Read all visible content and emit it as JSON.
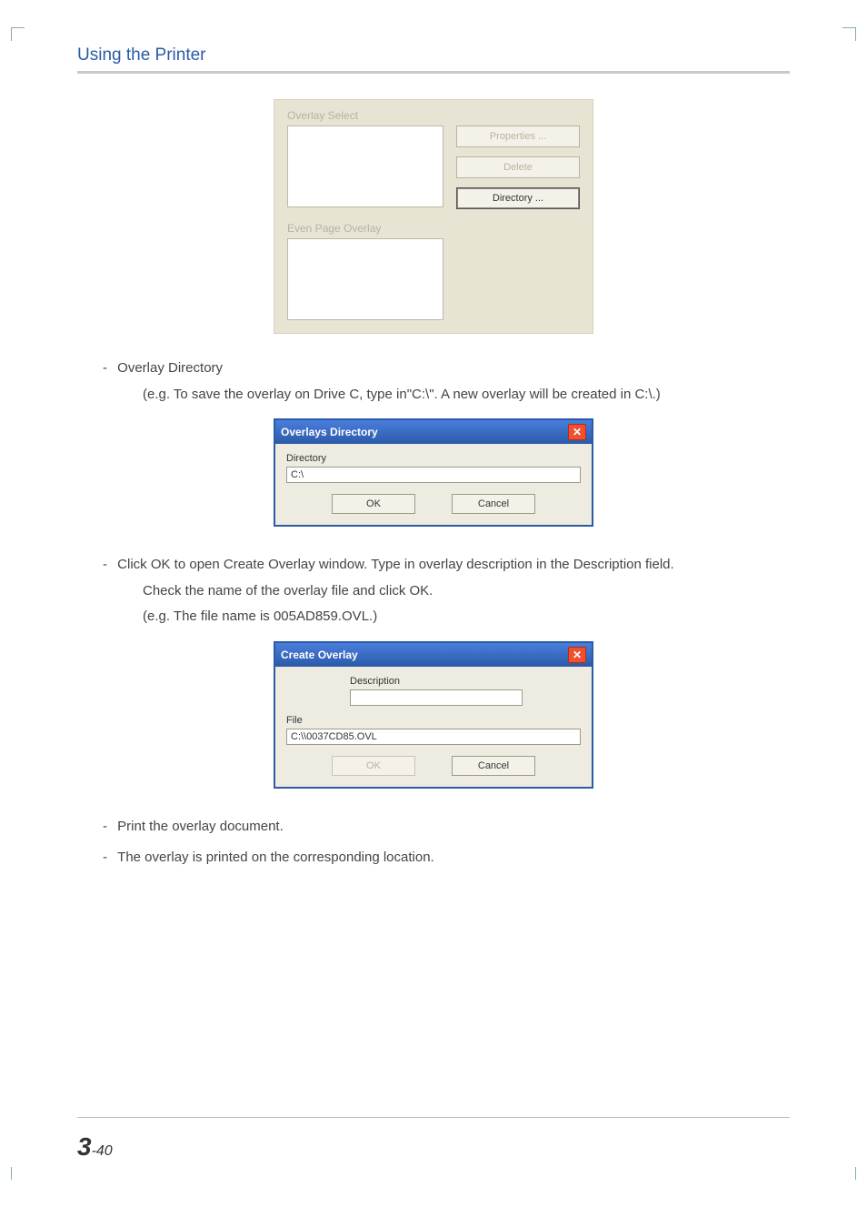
{
  "header": {
    "title": "Using the Printer"
  },
  "panel1": {
    "overlaySelectLabel": "Overlay Select",
    "evenPageOverlayLabel": "Even Page Overlay",
    "buttons": {
      "properties": "Properties ...",
      "delete": "Delete",
      "directory": "Directory ..."
    }
  },
  "text1": {
    "line1": "Overlay Directory",
    "line2": "(e.g. To save the overlay on Drive C, type in\"C:\\\". A new overlay will be created in C:\\.)"
  },
  "dialog1": {
    "title": "Overlays Directory",
    "dirLabel": "Directory",
    "dirValue": "C:\\",
    "ok": "OK",
    "cancel": "Cancel"
  },
  "text2": {
    "line1": "Click OK to open Create Overlay window. Type in overlay description in the Description field.",
    "line2": "Check the name of the overlay file and click OK.",
    "line3": "(e.g. The file name is 005AD859.OVL.)"
  },
  "dialog2": {
    "title": "Create Overlay",
    "descLabel": "Description",
    "descValue": "",
    "fileLabel": "File",
    "fileValue": "C:\\\\0037CD85.OVL",
    "ok": "OK",
    "cancel": "Cancel"
  },
  "text3": {
    "line1": "Print the overlay document.",
    "line2": "The overlay is printed on the corresponding location."
  },
  "pageNumber": {
    "chapter": "3",
    "sep": "-",
    "page": "40"
  }
}
